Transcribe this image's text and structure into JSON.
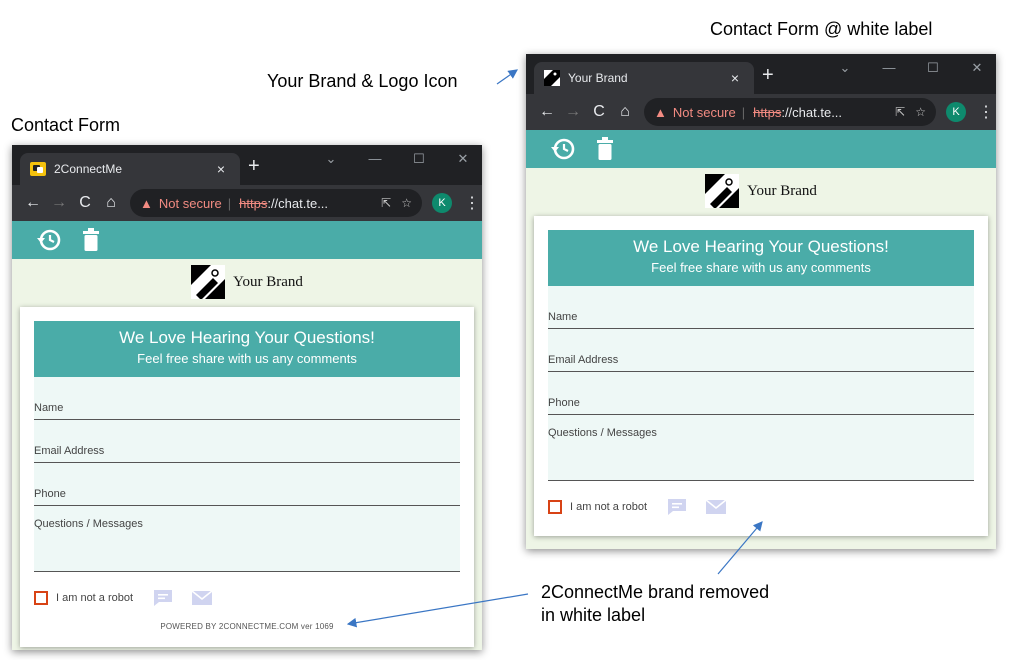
{
  "annotations": {
    "white_label_title": "Contact Form @ white label",
    "brand_logo_note": "Your Brand & Logo Icon",
    "contact_form_title": "Contact Form",
    "brand_removed_note": "2ConnectMe brand removed\nin white label"
  },
  "colors": {
    "teal": "#4aaca8",
    "page_bg": "#eef5e6",
    "field_bg": "#eef8f6",
    "checkbox_red": "#d84315",
    "icon_lavender": "#d0d4f0",
    "chrome_dark": "#202124",
    "annotation_arrow": "#3a76c4"
  },
  "left_window": {
    "tab_title": "2ConnectMe",
    "tab_close": "×",
    "new_tab": "+",
    "win_controls": [
      "⌄",
      "—",
      "☐",
      "✕"
    ],
    "nav": {
      "back": "←",
      "forward": "→",
      "reload": "C",
      "home": "⌂"
    },
    "address": {
      "warning_icon": "▲",
      "not_secure": "Not secure",
      "separator": "|",
      "scheme": "https",
      "url_rest": "://chat.te...",
      "share_icon": "⇱",
      "star_icon": "☆"
    },
    "avatar": "K",
    "menu": "⋮",
    "brand_text": "Your Brand",
    "form": {
      "title": "We Love Hearing Your Questions!",
      "subtitle": "Feel free share with us any comments",
      "fields": [
        "Name",
        "Email Address",
        "Phone"
      ],
      "message_label": "Questions / Messages",
      "robot_label": "I am not a robot",
      "powered_by": "POWERED BY 2CONNECTME.COM ver 1069"
    }
  },
  "right_window": {
    "tab_title": "Your Brand",
    "tab_close": "×",
    "new_tab": "+",
    "win_controls": [
      "⌄",
      "—",
      "☐",
      "✕"
    ],
    "nav": {
      "back": "←",
      "forward": "→",
      "reload": "C",
      "home": "⌂"
    },
    "address": {
      "warning_icon": "▲",
      "not_secure": "Not secure",
      "separator": "|",
      "scheme": "https",
      "url_rest": "://chat.te...",
      "share_icon": "⇱",
      "star_icon": "☆"
    },
    "avatar": "K",
    "menu": "⋮",
    "brand_text": "Your Brand",
    "form": {
      "title": "We Love Hearing Your Questions!",
      "subtitle": "Feel free share with us any comments",
      "fields": [
        "Name",
        "Email Address",
        "Phone"
      ],
      "message_label": "Questions / Messages",
      "robot_label": "I am not a robot"
    }
  }
}
